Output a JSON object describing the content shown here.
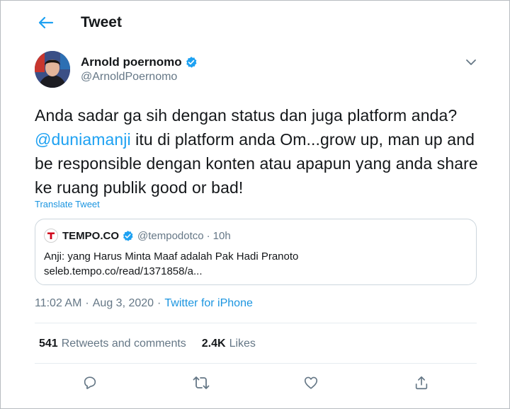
{
  "header": {
    "title": "Tweet"
  },
  "author": {
    "display_name": "Arnold poernomo",
    "handle": "@ArnoldPoernomo"
  },
  "tweet": {
    "text_before": "Anda sadar ga sih dengan status dan juga platform anda? ",
    "mention": "@duniamanji",
    "text_after": " itu di platform anda Om...grow up, man up and be responsible dengan konten atau apapun yang anda share ke ruang publik good or bad!",
    "translate_label": "Translate Tweet"
  },
  "quote": {
    "name": "TEMPO.CO",
    "handle": "@tempodotco",
    "dot": "·",
    "time": "10h",
    "line1": "Anji: yang Harus Minta Maaf adalah Pak Hadi Pranoto",
    "line2": "seleb.tempo.co/read/1371858/a..."
  },
  "meta": {
    "time": "11:02 AM",
    "sep": "·",
    "date": "Aug 3, 2020",
    "source": "Twitter for iPhone"
  },
  "stats": {
    "retweets_count": "541",
    "retweets_label": "Retweets and comments",
    "likes_count": "2.4K",
    "likes_label": "Likes"
  },
  "colors": {
    "accent": "#1da1f2",
    "muted": "#657786",
    "text": "#14171a",
    "border": "#ccd6dd",
    "verified": "#1da1f2",
    "tempo_red": "#d0021b"
  },
  "icons": {
    "back": "back-arrow-icon",
    "verified": "verified-badge-icon",
    "caret": "chevron-down-icon",
    "reply": "reply-icon",
    "retweet": "retweet-icon",
    "like": "heart-icon",
    "share": "share-icon"
  }
}
